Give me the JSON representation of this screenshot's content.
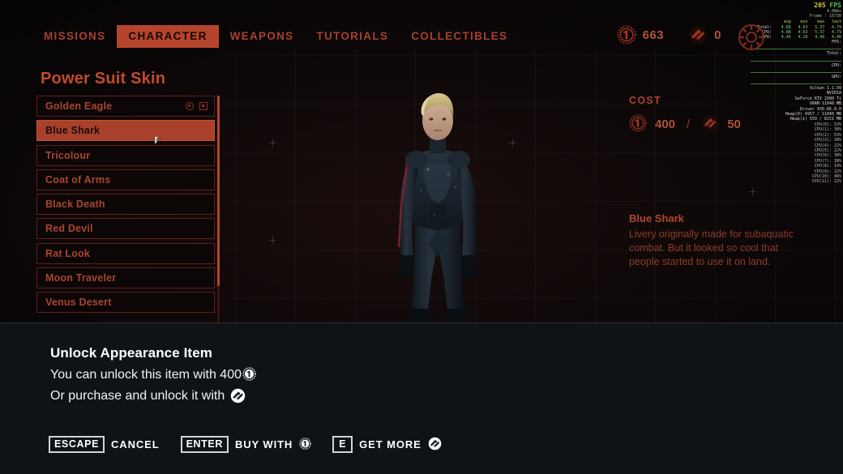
{
  "nav": {
    "tabs": [
      {
        "label": "MISSIONS",
        "active": false
      },
      {
        "label": "CHARACTER",
        "active": true
      },
      {
        "label": "WEAPONS",
        "active": false
      },
      {
        "label": "TUTORIALS",
        "active": false
      },
      {
        "label": "COLLECTIBLES",
        "active": false
      }
    ]
  },
  "currencies": {
    "coins": "663",
    "premium": "0",
    "coin_icon": "coin-icon",
    "premium_icon": "premium-currency-icon"
  },
  "panel": {
    "title": "Power Suit Skin",
    "items": [
      {
        "label": "Golden Eagle",
        "selected": false,
        "equipped": true
      },
      {
        "label": "Blue Shark",
        "selected": true,
        "equipped": false
      },
      {
        "label": "Tricolour",
        "selected": false,
        "equipped": false
      },
      {
        "label": "Coat of Arms",
        "selected": false,
        "equipped": false
      },
      {
        "label": "Black Death",
        "selected": false,
        "equipped": false
      },
      {
        "label": "Red Devil",
        "selected": false,
        "equipped": false
      },
      {
        "label": "Rat Look",
        "selected": false,
        "equipped": false
      },
      {
        "label": "Moon Traveler",
        "selected": false,
        "equipped": false
      },
      {
        "label": "Venus Desert",
        "selected": false,
        "equipped": false
      }
    ]
  },
  "details": {
    "cost_label": "COST",
    "cost_coins": "400",
    "cost_separator": "/",
    "cost_premium": "50",
    "item_name": "Blue Shark",
    "item_description": "Livery originally made for subaquatic combat. But it looked so cool that people started to use it on land."
  },
  "modal": {
    "title": "Unlock Appearance Item",
    "line1_text": "You can unlock this item with 400",
    "line2_text": "Or purchase and unlock it with",
    "prompts": [
      {
        "key": "ESCAPE",
        "label": "CANCEL",
        "icon": ""
      },
      {
        "key": "ENTER",
        "label": "BUY WITH",
        "icon": "coin-icon"
      },
      {
        "key": "E",
        "label": "GET MORE",
        "icon": "premium-currency-icon"
      }
    ]
  },
  "perf_overlay": {
    "fps": "205",
    "fps_unit": "FPS",
    "frametime": "4.88ms",
    "frame_label": "Frame :",
    "frame_number": "16730",
    "columns": [
      "avg",
      "min",
      "max",
      "last"
    ],
    "rows": [
      {
        "label": "Total:",
        "values": [
          "4.88",
          "4.63",
          "5.37",
          "4.79"
        ]
      },
      {
        "label": "CPU:",
        "values": [
          "4.88",
          "4.63",
          "5.37",
          "4.79"
        ]
      },
      {
        "label": "GPU:",
        "values": [
          "4.46",
          "4.28",
          "4.96",
          "4.48"
        ]
      }
    ],
    "graph_labels": [
      "FPS:",
      "Total:",
      "CPU:",
      "GPU:"
    ],
    "api": "Vulkan 1.1.99",
    "vendor": "NVIDIA",
    "gpu": "GeForce RTX 2080 Ti",
    "vram": "VRAM 11048 MB",
    "driver": "Driver 430.86.0.0",
    "heap0": "Heap(0) 4957 / 11048 MB",
    "heap1": "Heap(1) 559 / 8151 MB",
    "cpus": [
      {
        "label": "CPU(0):",
        "value": "53%"
      },
      {
        "label": "CPU(1):",
        "value": "38%"
      },
      {
        "label": "CPU(2):",
        "value": "53%"
      },
      {
        "label": "CPU(3):",
        "value": "38%"
      },
      {
        "label": "CPU(4):",
        "value": "22%"
      },
      {
        "label": "CPU(5):",
        "value": "22%"
      },
      {
        "label": "CPU(6):",
        "value": "38%"
      },
      {
        "label": "CPU(7):",
        "value": "38%"
      },
      {
        "label": "CPU(8):",
        "value": "14%"
      },
      {
        "label": "CPU(9):",
        "value": "22%"
      },
      {
        "label": "CPU(10):",
        "value": "46%"
      },
      {
        "label": "CPU(11):",
        "value": "22%"
      }
    ]
  },
  "colors": {
    "accent": "#b5442c",
    "text_red": "#a8462f",
    "modal_bg": "#0f1316"
  }
}
